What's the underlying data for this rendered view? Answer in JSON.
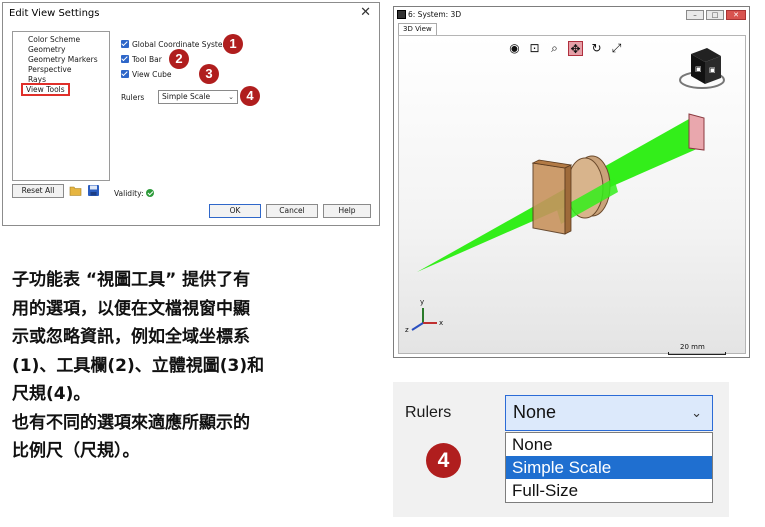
{
  "dialog": {
    "title": "Edit View Settings",
    "close_glyph": "✕",
    "tree_items": [
      "Color Scheme",
      "Geometry",
      "Geometry Markers",
      "Perspective",
      "Rays",
      "View Tools"
    ],
    "selected_item": "View Tools",
    "options": [
      {
        "label": "Global Coordinate System",
        "checked": true,
        "badge": "1"
      },
      {
        "label": "Tool Bar",
        "checked": true,
        "badge": "2"
      },
      {
        "label": "View Cube",
        "checked": true,
        "badge": "3"
      }
    ],
    "rulers_label": "Rulers",
    "rulers_value": "Simple Scale",
    "rulers_badge": "4",
    "reset_label": "Reset All",
    "validity_label": "Validity:",
    "ok_label": "OK",
    "cancel_label": "Cancel",
    "help_label": "Help"
  },
  "view_window": {
    "title": "6: System: 3D",
    "tab_label": "3D View",
    "scale_label": "20 mm",
    "axis_labels": {
      "x": "x",
      "y": "y",
      "z": "z"
    }
  },
  "description": {
    "lines": [
      "子功能表 “視圖工具” 提供了有",
      "用的選項，以便在文檔視窗中顯",
      "示或忽略資訊，例如全域坐標系",
      "(1)、工具欄(2)、立體視圖(3)和",
      "尺規(4)。",
      "也有不同的選項來適應所顯示的",
      "比例尺（尺規）。"
    ]
  },
  "rulers_zoom": {
    "label": "Rulers",
    "selected": "None",
    "badge": "4",
    "options": [
      "None",
      "Simple Scale",
      "Full-Size"
    ],
    "highlighted": "Simple Scale"
  },
  "colors": {
    "badge": "#b01e1e",
    "beam": "#33ee1a",
    "checkbox": "#2f67c9",
    "highlight": "#1f6fd0"
  }
}
